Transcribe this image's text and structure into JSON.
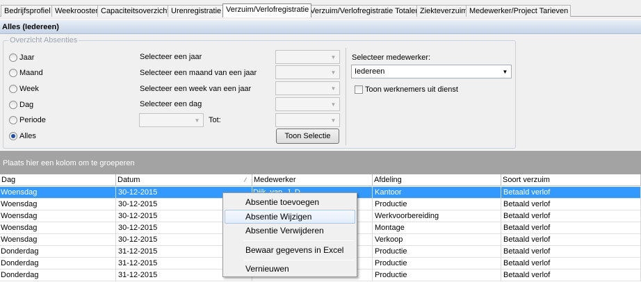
{
  "tabs": [
    {
      "label": "Bedrijfsprofiel"
    },
    {
      "label": "Weekrooster"
    },
    {
      "label": "Capaciteitsoverzicht"
    },
    {
      "label": "Urenregistratie"
    },
    {
      "label": "Verzuim/Verlofregistratie"
    },
    {
      "label": "Verzuim/Verlofregistratie Totalen"
    },
    {
      "label": "Ziekteverzuim"
    },
    {
      "label": "Medewerker/Project Tarieven"
    }
  ],
  "active_tab": "Verzuim/Verlofregistratie",
  "title": "Alles (Iedereen)",
  "overview": {
    "legend": "Overzicht Absenties",
    "radios": [
      {
        "label": "Jaar",
        "checked": false
      },
      {
        "label": "Maand",
        "checked": false
      },
      {
        "label": "Week",
        "checked": false
      },
      {
        "label": "Dag",
        "checked": false
      },
      {
        "label": "Periode",
        "checked": false
      },
      {
        "label": "Alles",
        "checked": true
      }
    ],
    "selectors": [
      {
        "label": "Selecteer een jaar"
      },
      {
        "label": "Selecteer een maand van een jaar"
      },
      {
        "label": "Selecteer een week van een jaar"
      },
      {
        "label": "Selecteer een dag"
      }
    ],
    "period_to_label": "Tot:",
    "show_button": "Toon Selectie",
    "employee_label": "Selecteer medewerker:",
    "employee_value": "Iedereen",
    "show_former_label": "Toon werknemers uit dienst",
    "show_former_checked": false
  },
  "group_hint": "Plaats hier een kolom om te groeperen",
  "grid": {
    "columns": [
      "Dag",
      "Datum",
      "Medewerker",
      "Afdeling",
      "Soort verzuim"
    ],
    "rows": [
      {
        "dag": "Woensdag",
        "datum": "30-12-2015",
        "medewerker": "Dijk, van, J. D.",
        "afdeling": "Kantoor",
        "soort": "Betaald verlof",
        "selected": true
      },
      {
        "dag": "Woensdag",
        "datum": "30-12-2015",
        "medewerker": "",
        "afdeling": "Productie",
        "soort": "Betaald verlof",
        "selected": false
      },
      {
        "dag": "Woensdag",
        "datum": "30-12-2015",
        "medewerker": "",
        "afdeling": "Werkvoorbereiding",
        "soort": "Betaald verlof",
        "selected": false
      },
      {
        "dag": "Woensdag",
        "datum": "30-12-2015",
        "medewerker": "",
        "afdeling": "Montage",
        "soort": "Betaald verlof",
        "selected": false
      },
      {
        "dag": "Woensdag",
        "datum": "30-12-2015",
        "medewerker": "",
        "afdeling": "Verkoop",
        "soort": "Betaald verlof",
        "selected": false
      },
      {
        "dag": "Donderdag",
        "datum": "31-12-2015",
        "medewerker": "",
        "afdeling": "Productie",
        "soort": "Betaald verlof",
        "selected": false
      },
      {
        "dag": "Donderdag",
        "datum": "31-12-2015",
        "medewerker": "",
        "afdeling": "Productie",
        "soort": "Betaald verlof",
        "selected": false
      },
      {
        "dag": "Donderdag",
        "datum": "31-12-2015",
        "medewerker": "",
        "afdeling": "Productie",
        "soort": "Betaald verlof",
        "selected": false
      }
    ]
  },
  "context_menu": {
    "items": [
      {
        "label": "Absentie toevoegen",
        "hover": false
      },
      {
        "label": "Absentie Wijzigen",
        "hover": true
      },
      {
        "label": "Absentie Verwijderen",
        "hover": false
      },
      {
        "label": "Bewaar gegevens in Excel",
        "hover": false
      },
      {
        "label": "Vernieuwen",
        "hover": false
      }
    ]
  }
}
